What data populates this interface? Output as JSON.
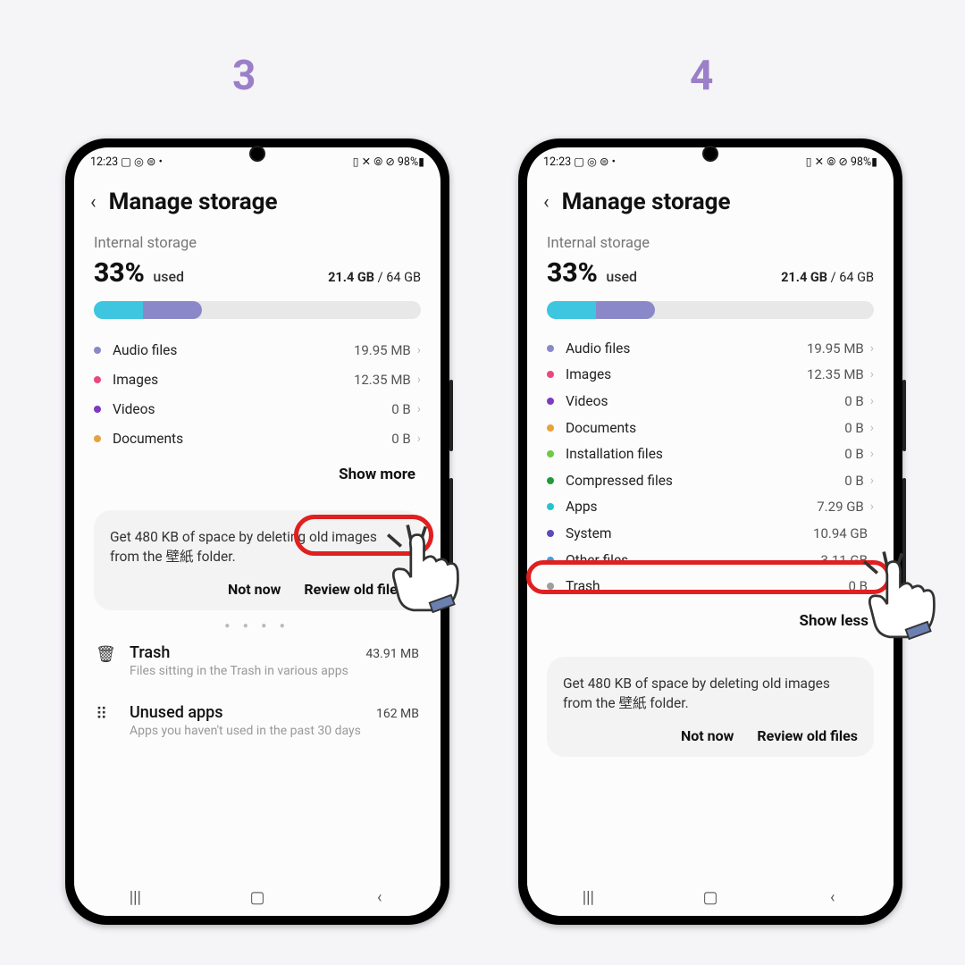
{
  "steps": {
    "s1": "3",
    "s2": "4"
  },
  "status": {
    "time": "12:23",
    "left_icons": "▢ ◎ ⊜ •",
    "right_icons": "▯ ✕ ⦾ ⊘ 98%▮"
  },
  "header": {
    "title": "Manage storage"
  },
  "storage": {
    "subtitle": "Internal storage",
    "percent": "33%",
    "used_label": "used",
    "used": "21.4 GB",
    "total": "/ 64 GB"
  },
  "colors": {
    "audio": "#8b88c9",
    "images": "#e8497d",
    "videos": "#7c3bc2",
    "documents": "#e8a23b",
    "install": "#6cc94a",
    "compressed": "#1f9b3b",
    "apps": "#26c3c9",
    "system": "#5a4bbf",
    "other": "#3aa0e0",
    "trash": "#9e9e9e"
  },
  "cats_short": [
    {
      "k": "audio",
      "label": "Audio files",
      "size": "19.95 MB"
    },
    {
      "k": "images",
      "label": "Images",
      "size": "12.35 MB"
    },
    {
      "k": "videos",
      "label": "Videos",
      "size": "0 B"
    },
    {
      "k": "documents",
      "label": "Documents",
      "size": "0 B"
    }
  ],
  "cats_full": [
    {
      "k": "audio",
      "label": "Audio files",
      "size": "19.95 MB",
      "chev": true
    },
    {
      "k": "images",
      "label": "Images",
      "size": "12.35 MB",
      "chev": true
    },
    {
      "k": "videos",
      "label": "Videos",
      "size": "0 B",
      "chev": true
    },
    {
      "k": "documents",
      "label": "Documents",
      "size": "0 B",
      "chev": true
    },
    {
      "k": "install",
      "label": "Installation files",
      "size": "0 B",
      "chev": true
    },
    {
      "k": "compressed",
      "label": "Compressed files",
      "size": "0 B",
      "chev": true
    },
    {
      "k": "apps",
      "label": "Apps",
      "size": "7.29 GB",
      "chev": true
    },
    {
      "k": "system",
      "label": "System",
      "size": "10.94 GB",
      "chev": false
    },
    {
      "k": "other",
      "label": "Other files",
      "size": "3.11 GB",
      "chev": false
    },
    {
      "k": "trash",
      "label": "Trash",
      "size": "0 B",
      "chev": false
    }
  ],
  "show_more": "Show more",
  "show_less": "Show less",
  "tip": {
    "text": "Get 480 KB of space by deleting old images from the 壁紙 folder.",
    "not_now": "Not now",
    "review": "Review old files"
  },
  "bottom": {
    "trash": {
      "title": "Trash",
      "size": "43.91 MB",
      "sub": "Files sitting in the Trash in various apps"
    },
    "unused": {
      "title": "Unused apps",
      "size": "162 MB",
      "sub": "Apps you haven't used in the past 30 days"
    }
  }
}
